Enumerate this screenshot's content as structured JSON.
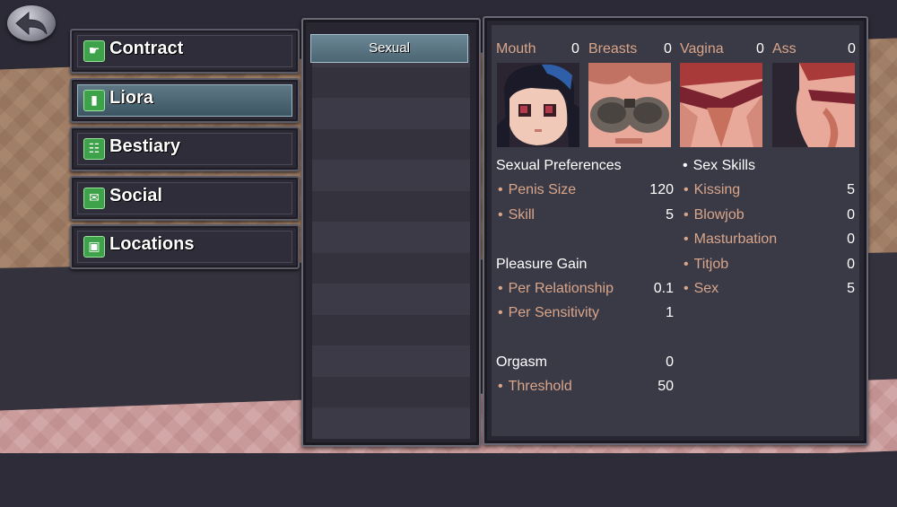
{
  "menu": {
    "items": [
      {
        "label": "Contract",
        "icon": "contract-icon",
        "active": false
      },
      {
        "label": "Liora",
        "icon": "book-icon",
        "active": true
      },
      {
        "label": "Bestiary",
        "icon": "bestiary-icon",
        "active": false
      },
      {
        "label": "Social",
        "icon": "mail-icon",
        "active": false
      },
      {
        "label": "Locations",
        "icon": "map-icon",
        "active": false
      }
    ]
  },
  "tabs": {
    "selected": "Sexual"
  },
  "body_parts": [
    {
      "label": "Mouth",
      "value": "0"
    },
    {
      "label": "Breasts",
      "value": "0"
    },
    {
      "label": "Vagina",
      "value": "0"
    },
    {
      "label": "Ass",
      "value": "0"
    }
  ],
  "preferences": {
    "title": "Sexual Preferences",
    "items": [
      {
        "label": "Penis Size",
        "value": "120"
      },
      {
        "label": "Skill",
        "value": "5"
      }
    ]
  },
  "pleasure": {
    "title": "Pleasure Gain",
    "items": [
      {
        "label": "Per Relationship",
        "value": "0.1"
      },
      {
        "label": "Per Sensitivity",
        "value": "1"
      }
    ]
  },
  "orgasm": {
    "title": "Orgasm",
    "value": "0",
    "items": [
      {
        "label": "Threshold",
        "value": "50"
      }
    ]
  },
  "skills": {
    "title": "Sex Skills",
    "items": [
      {
        "label": "Kissing",
        "value": "5"
      },
      {
        "label": "Blowjob",
        "value": "0"
      },
      {
        "label": "Masturbation",
        "value": "0"
      },
      {
        "label": "Titjob",
        "value": "0"
      },
      {
        "label": "Sex",
        "value": "5"
      }
    ]
  },
  "colors": {
    "accent_label": "#d9a68a",
    "icon_green": "#3ea24a",
    "active_tab": "#5f7886"
  }
}
